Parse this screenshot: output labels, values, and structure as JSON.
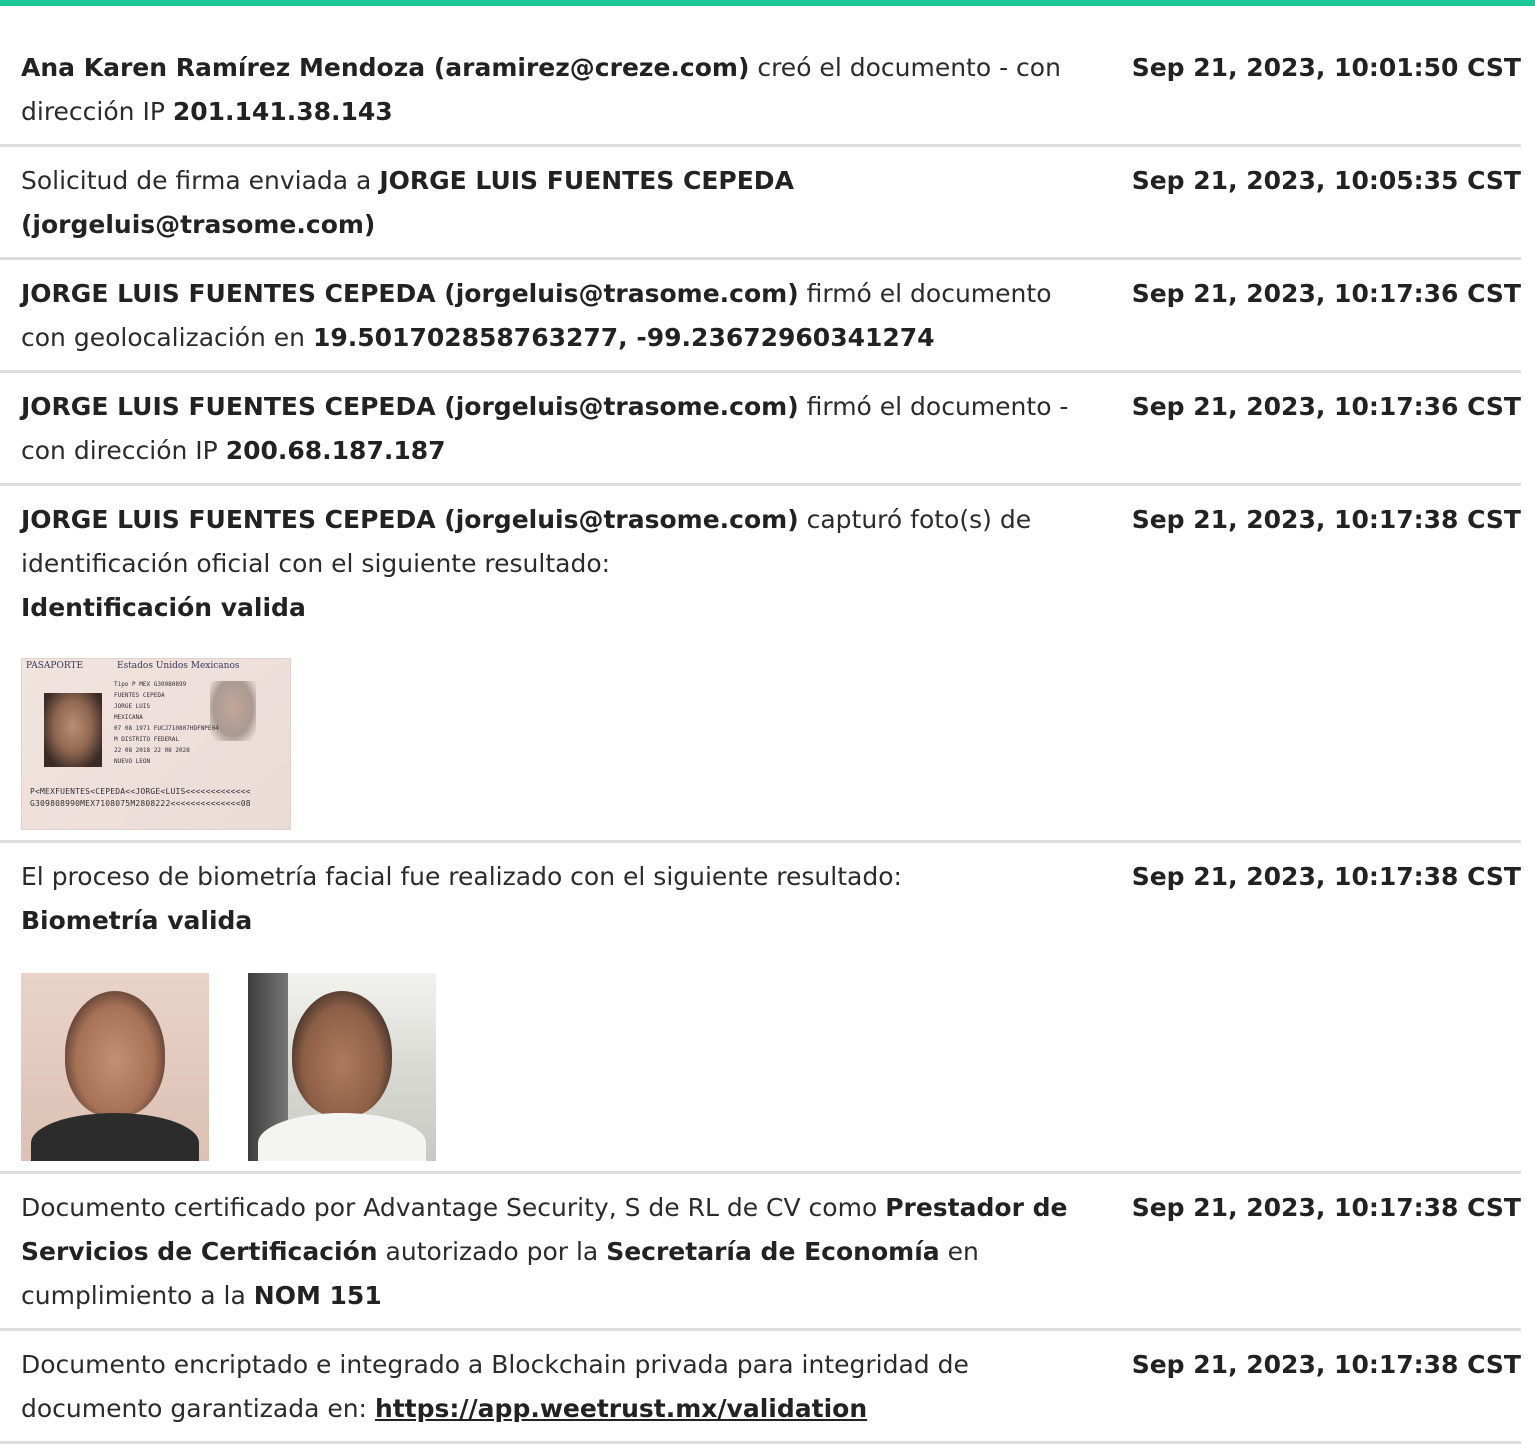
{
  "accent_color": "#1dc99b",
  "entries": [
    {
      "desc": [
        {
          "t": "Ana Karen Ramírez Mendoza (aramirez@creze.com)",
          "b": true
        },
        {
          "t": " creó el documento - con dirección IP "
        },
        {
          "t": "201.141.38.143",
          "b": true
        }
      ],
      "timestamp": "Sep 21, 2023, 10:01:50 CST"
    },
    {
      "desc": [
        {
          "t": "Solicitud de firma enviada a "
        },
        {
          "t": "JORGE LUIS FUENTES CEPEDA (jorgeluis@trasome.com)",
          "b": true
        }
      ],
      "timestamp": "Sep 21, 2023, 10:05:35 CST"
    },
    {
      "desc": [
        {
          "t": "JORGE LUIS FUENTES CEPEDA (jorgeluis@trasome.com)",
          "b": true
        },
        {
          "t": " firmó el documento con geolocalización en "
        },
        {
          "t": "19.501702858763277, -99.23672960341274",
          "b": true
        }
      ],
      "timestamp": "Sep 21, 2023, 10:17:36 CST"
    },
    {
      "desc": [
        {
          "t": "JORGE LUIS FUENTES CEPEDA (jorgeluis@trasome.com)",
          "b": true
        },
        {
          "t": " firmó el documento - con dirección IP "
        },
        {
          "t": "200.68.187.187",
          "b": true
        }
      ],
      "timestamp": "Sep 21, 2023, 10:17:36 CST"
    },
    {
      "desc": [
        {
          "t": "JORGE LUIS FUENTES CEPEDA (jorgeluis@trasome.com)",
          "b": true
        },
        {
          "t": " capturó foto(s) de identificación oficial con el siguiente resultado:"
        },
        {
          "br": true
        },
        {
          "t": "Identificación valida",
          "b": true
        }
      ],
      "timestamp": "Sep 21, 2023, 10:17:38 CST",
      "passport": {
        "header_left": "PASAPORTE",
        "header_right": "Estados Unidos Mexicanos",
        "lines": [
          "Tipo P   MEX    G30980899",
          "FUENTES CEPEDA",
          "JORGE LUIS",
          "MEXICANA",
          "07 08 1971   FUCJ710807HDFNPE04",
          "M    DISTRITO FEDERAL",
          "22 08 2018   22 08 2028",
          "NUEVO LEON"
        ],
        "mrz": [
          "P<MEXFUENTES<CEPEDA<<JORGE<LUIS<<<<<<<<<<<<<",
          "G309808990MEX7108075M2808222<<<<<<<<<<<<<<08"
        ]
      }
    },
    {
      "desc": [
        {
          "t": "El proceso de biometría facial fue realizado con el siguiente resultado:"
        },
        {
          "br": true
        },
        {
          "t": "Biometría valida",
          "b": true
        }
      ],
      "timestamp": "Sep 21, 2023, 10:17:38 CST",
      "faces": true
    },
    {
      "desc": [
        {
          "t": "Documento certificado por Advantage Security, S de RL de CV como "
        },
        {
          "t": "Prestador de Servicios de Certificación",
          "b": true
        },
        {
          "t": " autorizado por la "
        },
        {
          "t": "Secretaría de Economía",
          "b": true
        },
        {
          "t": " en cumplimiento a la "
        },
        {
          "t": "NOM 151",
          "b": true
        }
      ],
      "timestamp": "Sep 21, 2023, 10:17:38 CST"
    },
    {
      "desc": [
        {
          "t": "Documento encriptado e integrado a Blockchain privada para integridad de documento garantizada en: "
        },
        {
          "t": "https://app.weetrust.mx/validation",
          "link": true
        }
      ],
      "timestamp": "Sep 21, 2023, 10:17:38 CST"
    }
  ]
}
